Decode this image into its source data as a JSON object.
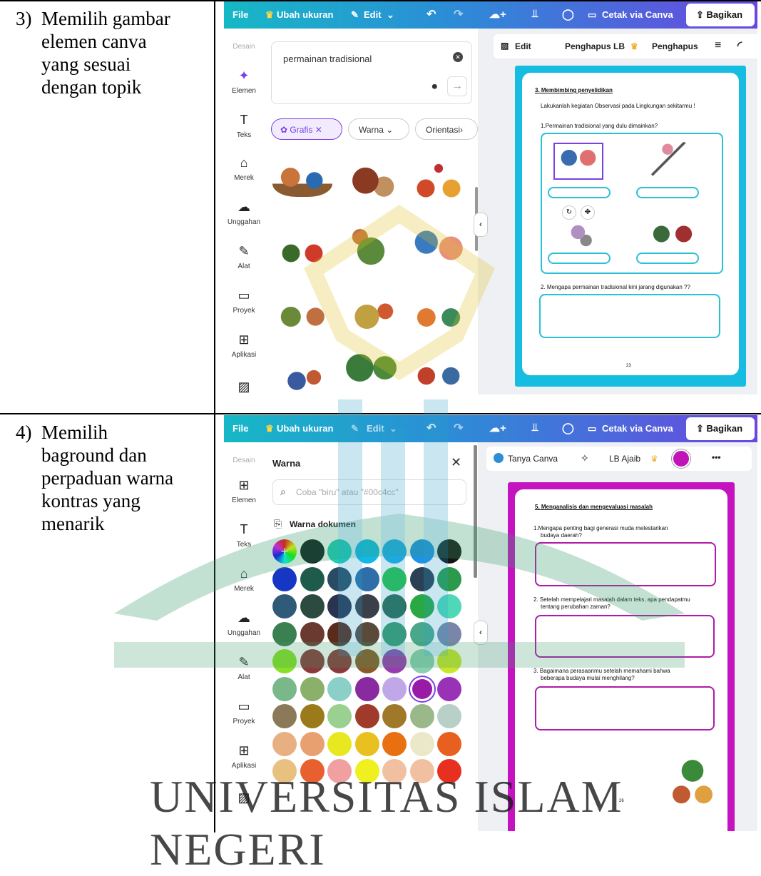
{
  "rows": [
    {
      "num": "3)",
      "lines": [
        "Memilih gambar",
        "elemen canva",
        "yang sesuai",
        "dengan topik"
      ]
    },
    {
      "num": "4)",
      "lines": [
        "Memilih",
        "baground dan",
        "perpaduan warna",
        "kontras yang",
        "menarik"
      ]
    }
  ],
  "topbar": {
    "file": "File",
    "resize": "Ubah ukuran",
    "edit": "Edit",
    "print": "Cetak via Canva",
    "share": "Bagikan"
  },
  "sidebar": {
    "design": "Desain",
    "items": [
      "Elemen",
      "Teks",
      "Merek",
      "Unggahan",
      "Alat",
      "Proyek",
      "Aplikasi"
    ]
  },
  "shot1": {
    "search_value": "permainan tradisional",
    "filters": [
      "Grafis",
      "Warna",
      "Orientasi"
    ],
    "toolbar": [
      "Edit",
      "Penghapus LB",
      "Penghapus"
    ],
    "doc": {
      "heading": "3. Membimbing penyelidikan",
      "instruction": "Lakukanlah kegiatan Observasi pada Lingkungan sekitarmu !",
      "q1": "1.Permainan tradisional yang dulu dimainkan?",
      "q2": "2. Mengapa permainan tradisional kini jarang digunakan ??",
      "page": "23"
    }
  },
  "shot2": {
    "panel_title": "Warna",
    "search_placeholder": "Coba \"biru\" atau \"#00c4cc\"",
    "doc_colors": "Warna dokumen",
    "toolbar": [
      "Tanya Canva",
      "LB Ajaib"
    ],
    "doc": {
      "heading": "5. Menganalisis dan mengevaluasi masalah",
      "q1a": "1.Mengapa penting bagi generasi muda melestarikan",
      "q1b": "budaya daerah?",
      "q2a": "2. Setelah mempelajari masalah dalam teks, apa pendapatmu",
      "q2b": "tentang perubahan zaman?",
      "q3a": "3. Bagaimana perasaanmu setelah memahami bahwa",
      "q3b": "beberapa budaya mulai menghilang?",
      "page": "26"
    },
    "colors": [
      [
        "#0b1a1a",
        "#1ccfb8",
        "#11b9ea",
        "#1aaee8",
        "#1d92e6",
        "#141414"
      ],
      [
        "#1637c4",
        "#1e5b4b",
        "#2a4b64",
        "#2f6ea8",
        "#27c24a",
        "#2b4052",
        "#2b9a4c"
      ],
      [
        "#2f5a78",
        "#2d4a40",
        "#2a3450",
        "#3a3f4a",
        "#2d6a50",
        "#2aa844",
        "#4ed8b8"
      ],
      [
        "#3a8050",
        "#6a3a30",
        "#5a2a1a",
        "#5a4a3a",
        "#3a9a6a",
        "#4aa88a",
        "#7a86a8"
      ],
      [
        "#88e026",
        "#8a3a3a",
        "#8a3a3a",
        "#8a5a2a",
        "#9a3ab0",
        "#8ad0b0",
        "#c8e62a"
      ],
      [
        "#7ab88a",
        "#8ab06a",
        "#8ad0c8",
        "#8a2aa0",
        "#c0a8e8",
        "#9a1aa8",
        "#9a32b8"
      ],
      [
        "#8a7a5a",
        "#9a7a1a",
        "#9ad090",
        "#a03a2a",
        "#a0782a",
        "#9ab88a",
        "#b8d0c8"
      ],
      [
        "#e8b080",
        "#e8a070",
        "#e8e820",
        "#e8c020",
        "#e87010",
        "#eae8c8",
        "#e86020"
      ],
      [
        "#e8c080",
        "#e86030",
        "#f0a0a0",
        "#f0f020",
        "#f0c0a0",
        "#f0c0a0",
        "#e83020"
      ]
    ]
  },
  "watermark": {
    "line1": "UNIVERSITAS ISLAM NEGERI"
  }
}
